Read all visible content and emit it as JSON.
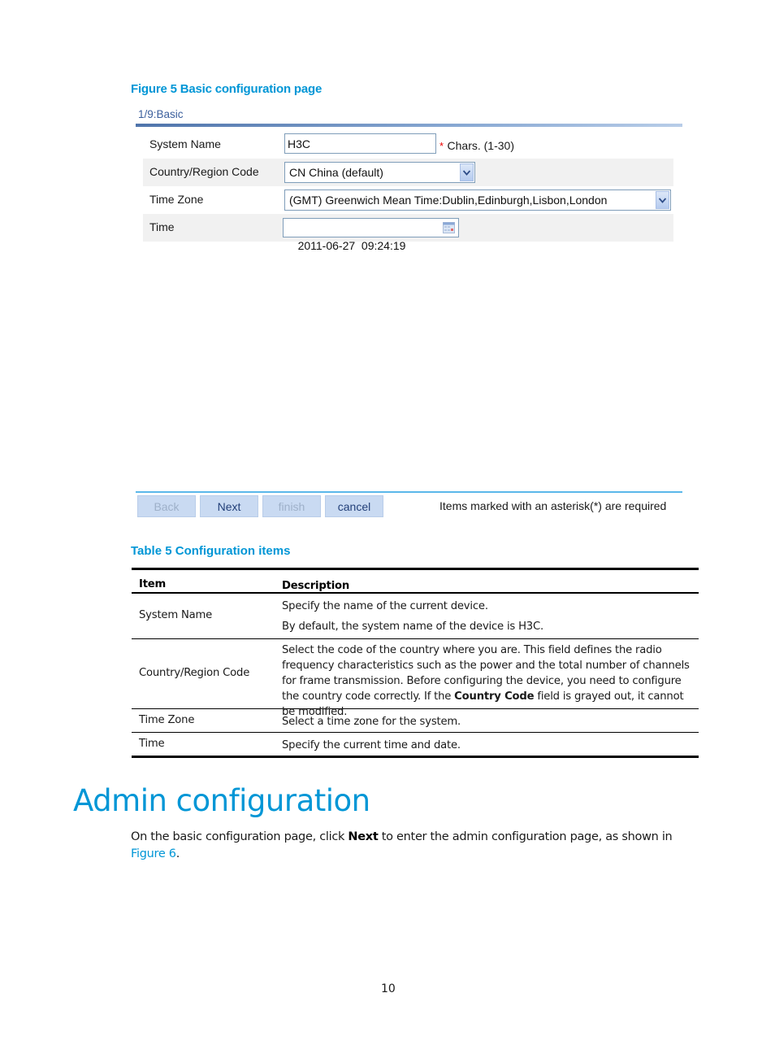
{
  "figure_caption": "Figure 5 Basic configuration page",
  "wizard": {
    "step_title": "1/9:Basic",
    "fields": {
      "system_name": {
        "label": "System Name",
        "value": "H3C",
        "required_mark": "*",
        "hint": "Chars. (1-30)"
      },
      "country_code": {
        "label": "Country/Region Code",
        "selected": "CN China (default)"
      },
      "time_zone": {
        "label": "Time Zone",
        "selected": "(GMT) Greenwich Mean Time:Dublin,Edinburgh,Lisbon,London"
      },
      "time": {
        "label": "Time",
        "value": "2011-06-27  09:24:19"
      }
    },
    "buttons": {
      "back": "Back",
      "next": "Next",
      "finish": "finish",
      "cancel": "cancel"
    },
    "required_note": "Items marked with an asterisk(*) are required"
  },
  "table_caption": "Table 5 Configuration items",
  "table": {
    "headers": [
      "Item",
      "Description"
    ],
    "rows": [
      {
        "item": "System Name",
        "desc_lines": [
          "Specify the name of the current device.",
          "By default, the system name of the device is H3C."
        ]
      },
      {
        "item": "Country/Region Code",
        "desc_pre": "Select the code of the country where you are. This field defines the radio frequency characteristics such as the power and the total number of channels for frame transmission. Before configuring the device, you need to configure the country code correctly. If the ",
        "desc_bold": "Country Code",
        "desc_post": " field is grayed out, it cannot be modified."
      },
      {
        "item": "Time Zone",
        "desc": "Select a time zone for the system."
      },
      {
        "item": "Time",
        "desc": "Specify the current time and date."
      }
    ]
  },
  "section": {
    "title": "Admin configuration",
    "para_pre": "On the basic configuration page, click ",
    "para_bold": "Next",
    "para_mid": " to enter the admin configuration page, as shown in ",
    "para_link": "Figure 6",
    "para_post": "."
  },
  "page_number": "10",
  "colors": {
    "accent": "#0096d6",
    "button_bg": "#c9daf2",
    "alt_row": "#f1f1f1"
  }
}
